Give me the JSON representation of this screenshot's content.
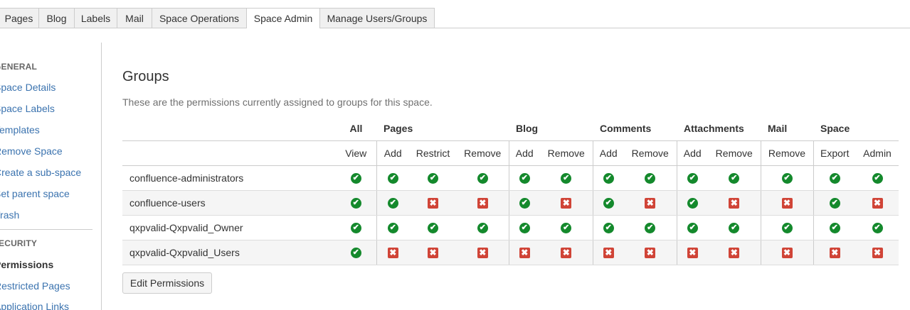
{
  "tabs": [
    "Pages",
    "Blog",
    "Labels",
    "Mail",
    "Space Operations",
    "Space Admin",
    "Manage Users/Groups"
  ],
  "active_tab": "Space Admin",
  "sidebar": {
    "general_heading": "GENERAL",
    "general_items": [
      "Space Details",
      "Space Labels",
      "Templates",
      "Remove Space",
      "Create a sub-space",
      "Set parent space",
      "Trash"
    ],
    "security_heading": "ECURITY",
    "security_items": [
      "Permissions",
      "Restricted Pages",
      "Application Links"
    ],
    "current_item": "Permissions"
  },
  "main": {
    "title": "Groups",
    "description": "These are the permissions currently assigned to groups for this space.",
    "categories": [
      "All",
      "Pages",
      "Blog",
      "Comments",
      "Attachments",
      "Mail",
      "Space"
    ],
    "columns": [
      "View",
      "Add",
      "Restrict",
      "Remove",
      "Add",
      "Remove",
      "Add",
      "Remove",
      "Add",
      "Remove",
      "Remove",
      "Export",
      "Admin"
    ],
    "rows": [
      {
        "group": "confluence-administrators",
        "perms": [
          true,
          true,
          true,
          true,
          true,
          true,
          true,
          true,
          true,
          true,
          true,
          true,
          true
        ]
      },
      {
        "group": "confluence-users",
        "perms": [
          true,
          true,
          false,
          false,
          true,
          false,
          true,
          false,
          true,
          false,
          false,
          true,
          false
        ]
      },
      {
        "group": "qxpvalid-Qxpvalid_Owner",
        "perms": [
          true,
          true,
          true,
          true,
          true,
          true,
          true,
          true,
          true,
          true,
          true,
          true,
          true
        ]
      },
      {
        "group": "qxpvalid-Qxpvalid_Users",
        "perms": [
          true,
          false,
          false,
          false,
          false,
          false,
          false,
          false,
          false,
          false,
          false,
          false,
          false
        ]
      }
    ],
    "edit_button": "Edit Permissions"
  },
  "icons": {
    "granted": "check-circle-icon",
    "denied": "cross-square-icon"
  },
  "colors": {
    "granted": "#14892c",
    "denied": "#d04437",
    "link": "#3b73af"
  }
}
